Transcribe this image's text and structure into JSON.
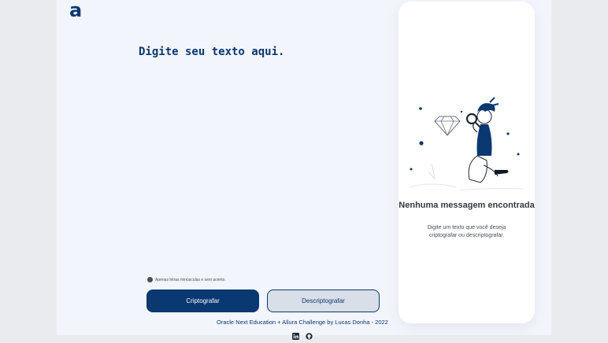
{
  "brand": {
    "logo_letter": "a"
  },
  "input": {
    "placeholder": "Digite seu texto aqui."
  },
  "hint": {
    "text": "Apenas letras minúsculas e sem acento."
  },
  "buttons": {
    "encrypt": "Criptografar",
    "decrypt": "Descriptografar"
  },
  "footer": {
    "credit": "Oracle Next Education + Allura Challenge by Lucas Donha - 2022"
  },
  "panel": {
    "title": "Nenhuma messagem encontrada",
    "description": "Digite um texto que você deseja criptografar ou descriptografar."
  },
  "social": [
    "linkedin-icon",
    "github-icon"
  ],
  "colors": {
    "primary": "#0a3871",
    "background": "#f3f5fc"
  }
}
